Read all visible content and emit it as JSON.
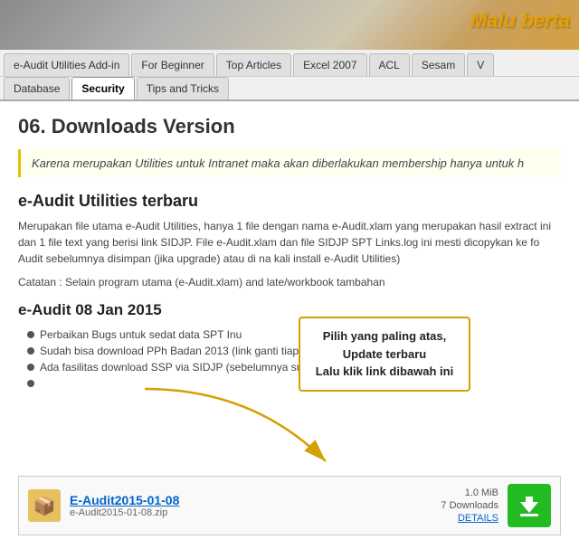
{
  "header": {
    "banner_text": "Malu berta"
  },
  "nav": {
    "row1_tabs": [
      {
        "label": "e-Audit Utilities Add-in",
        "active": false
      },
      {
        "label": "For Beginner",
        "active": false
      },
      {
        "label": "Top Articles",
        "active": false
      },
      {
        "label": "Excel 2007",
        "active": false
      },
      {
        "label": "ACL",
        "active": false
      },
      {
        "label": "Sesam",
        "active": false
      },
      {
        "label": "V",
        "active": false
      }
    ],
    "row2_tabs": [
      {
        "label": "Database",
        "active": false
      },
      {
        "label": "Security",
        "active": true
      },
      {
        "label": "Tips and Tricks",
        "active": false
      }
    ]
  },
  "page": {
    "title": "06. Downloads Version",
    "notice": "Karena merupakan Utilities untuk Intranet maka akan diberlakukan membership hanya untuk h",
    "section1_title": "e-Audit Utilities terbaru",
    "section1_desc": "Merupakan file utama e-Audit Utilities, hanya 1 file dengan nama e-Audit.xlam yang merupakan hasil extract ini dan 1 file text yang berisi link SIDJP. File e-Audit.xlam dan file SIDJP SPT Links.log ini mesti dicopykan ke fo Audit sebelumnya disimpan (jika upgrade) atau di                                      na kali install e-Audit Utilities)",
    "catatan": "Catatan : Selain program utama (e-Audit.xlam) and                                   late/workbook tambahan",
    "section2_title": "e-Audit 08 Jan 2015",
    "bullets": [
      "Perbaikan Bugs untuk sedat data SPT Inu",
      "Sudah bisa download PPh Badan 2013 (link ganti tiap session/login)",
      "Ada fasilitas download SSP via SIDJP (sebelumnya sudah ada via OPDP dan Appportal)"
    ],
    "bullet4": "",
    "callout": {
      "line1": "Pilih yang paling atas,",
      "line2": "Update terbaru",
      "line3": "Lalu klik link dibawah ini"
    },
    "download": {
      "icon": "📦",
      "name": "E-Audit2015-01-08",
      "filename": "e-Audit2015-01-08.zip",
      "size": "1.0 MiB",
      "downloads": "7 Downloads",
      "details_label": "DETAILS"
    }
  }
}
